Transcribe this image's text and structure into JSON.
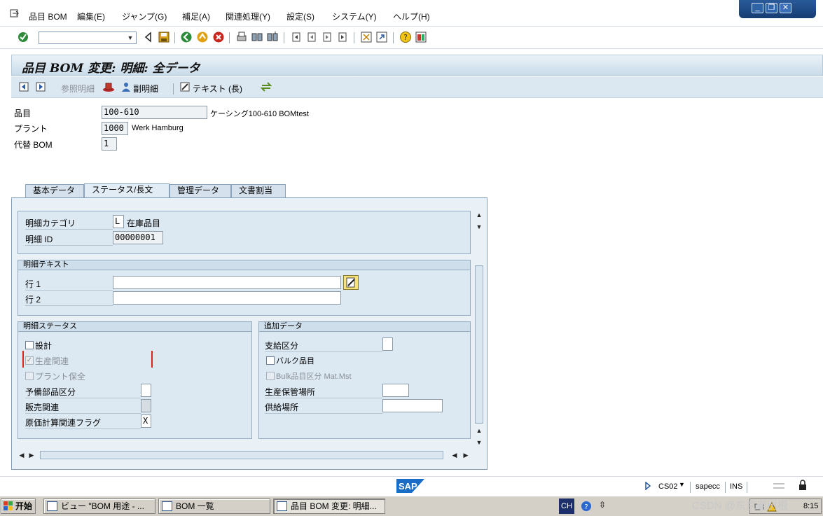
{
  "menu": {
    "items": [
      "品目 BOM",
      "編集(E)",
      "ジャンプ(G)",
      "補足(A)",
      "関連処理(Y)",
      "設定(S)",
      "システム(Y)",
      "ヘルプ(H)"
    ]
  },
  "title": "品目 BOM 変更: 明細: 全データ",
  "app_toolbar": {
    "ref_detail": "参照明細",
    "sub_detail": "副明細",
    "text_long": "テキスト (長)"
  },
  "header": {
    "material_label": "品目",
    "material_value": "100-610",
    "material_desc": "ケーシング100-610 BOMtest",
    "plant_label": "プラント",
    "plant_value": "1000",
    "plant_desc": "Werk Hamburg",
    "alt_bom_label": "代替 BOM",
    "alt_bom_value": "1"
  },
  "tabs": [
    "基本データ",
    "ステータス/長文",
    "管理データ",
    "文書割当"
  ],
  "item_section": {
    "category_label": "明細カテゴリ",
    "category_value": "L",
    "category_desc": "在庫品目",
    "id_label": "明細 ID",
    "id_value": "00000001"
  },
  "item_text": {
    "title": "明細テキスト",
    "line1_label": "行 1",
    "line1_value": "",
    "line2_label": "行 2",
    "line2_value": ""
  },
  "item_status": {
    "title": "明細ステータス",
    "design_label": "設計",
    "design_checked": false,
    "production_label": "生産関連",
    "production_checked": true,
    "plant_maint_label": "プラント保全",
    "plant_maint_checked": false,
    "spare_part_label": "予備部品区分",
    "spare_part_value": "",
    "sales_label": "販売関連",
    "sales_value": "",
    "costing_label": "原価計算関連フラグ",
    "costing_value": "X"
  },
  "additional": {
    "title": "追加データ",
    "supply_label": "支給区分",
    "supply_value": "",
    "bulk_label": "バルク品目",
    "bulk_checked": false,
    "bulk_mat_label": "Bulk品目区分 Mat.Mst",
    "bulk_mat_checked": false,
    "prod_sloc_label": "生産保管場所",
    "prod_sloc_value": "",
    "supply_area_label": "供給場所",
    "supply_area_value": ""
  },
  "status_bar": {
    "transaction": "CS02",
    "system": "sapecc",
    "mode": "INS",
    "time": "8:15"
  },
  "taskbar": {
    "start": "开始",
    "tasks": [
      "ビュー \"BOM 用途 - ...",
      "BOM 一覧",
      "品目 BOM 変更: 明細..."
    ],
    "lang": "CH",
    "watermark": "CSDN @东京老树根"
  }
}
